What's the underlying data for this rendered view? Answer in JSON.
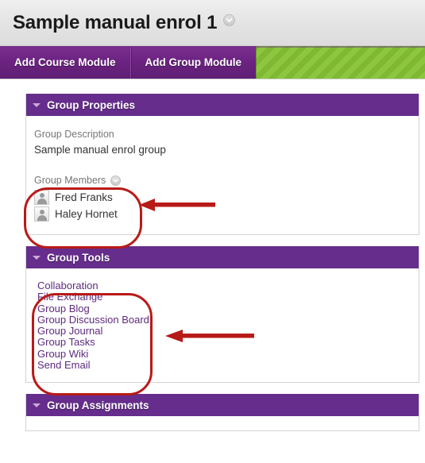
{
  "header": {
    "title": "Sample manual enrol 1",
    "title_menu_icon": "chevron-down-circle-icon"
  },
  "action_bar": {
    "tabs": [
      {
        "label": "Add Course Module"
      },
      {
        "label": "Add Group Module"
      }
    ],
    "stripe_color": "#8dc63f"
  },
  "colors": {
    "panel_header": "#662d8c",
    "tab_bar": "#6b2280",
    "link": "#5d2b7e",
    "annotation": "#b81a18"
  },
  "panels": {
    "group_properties": {
      "title": "Group Properties",
      "caret_icon": "caret-down-icon",
      "description_label": "Group Description",
      "description_value": "Sample manual enrol group",
      "members_label": "Group Members",
      "members_icon": "chevron-down-circle-icon",
      "members": [
        {
          "name": "Fred Franks",
          "avatar_icon": "user-avatar-icon"
        },
        {
          "name": "Haley Hornet",
          "avatar_icon": "user-avatar-icon"
        }
      ]
    },
    "group_tools": {
      "title": "Group Tools",
      "caret_icon": "caret-down-icon",
      "tools": [
        {
          "label": "Collaboration"
        },
        {
          "label": "File Exchange"
        },
        {
          "label": "Group Blog"
        },
        {
          "label": "Group Discussion Board"
        },
        {
          "label": "Group Journal"
        },
        {
          "label": "Group Tasks"
        },
        {
          "label": "Group Wiki"
        },
        {
          "label": "Send Email"
        }
      ]
    },
    "group_assignments": {
      "title": "Group Assignments",
      "caret_icon": "caret-down-icon"
    }
  },
  "annotations": {
    "members_highlight": {
      "shape": "rounded-rectangle",
      "color": "#b81a18"
    },
    "members_arrow": {
      "shape": "arrow-left",
      "color": "#b81a18"
    },
    "tools_highlight": {
      "shape": "rounded-rectangle",
      "color": "#b81a18"
    },
    "tools_arrow": {
      "shape": "arrow-left",
      "color": "#b81a18"
    }
  }
}
